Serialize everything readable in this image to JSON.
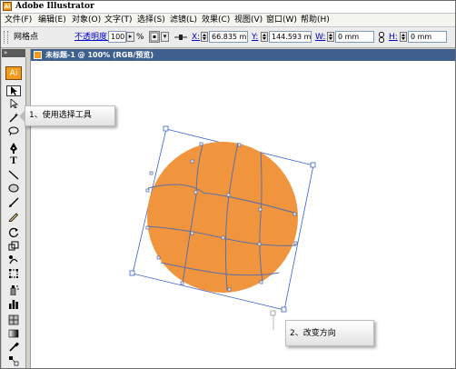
{
  "app": {
    "title": "Adobe Illustrator",
    "icon_text": "Ai"
  },
  "menu": [
    "文件(F)",
    "编辑(E)",
    "对象(O)",
    "文字(T)",
    "选择(S)",
    "滤镜(L)",
    "效果(C)",
    "视图(V)",
    "窗口(W)",
    "帮助(H)"
  ],
  "control_bar": {
    "selection_label": "网格点",
    "opacity_label": "不透明度:",
    "opacity_value": "100",
    "percent": "%",
    "x_label": "X:",
    "x_value": "66.835 mm",
    "y_label": "Y:",
    "y_value": "144.593 mm",
    "w_label": "W:",
    "w_value": "0 mm",
    "h_label": "H:",
    "h_value": "0 mm"
  },
  "toolbox": {
    "logo": "Ai",
    "tools": [
      "selection-tool",
      "direct-selection-tool",
      "magic-wand-tool",
      "lasso-tool",
      "pen-tool",
      "type-tool",
      "line-segment-tool",
      "ellipse-tool",
      "paintbrush-tool",
      "pencil-tool",
      "rotate-tool",
      "scale-tool",
      "warp-tool",
      "free-transform-tool",
      "symbol-sprayer-tool",
      "column-graph-tool",
      "mesh-tool",
      "gradient-tool",
      "eyedropper-tool",
      "blend-tool"
    ],
    "type_glyph": "T"
  },
  "document": {
    "tab_title": "未标题-1 @ 100% (RGB/预览)"
  },
  "callouts": {
    "step1": "1、使用选择工具",
    "step2": "2、改变方向"
  },
  "colors": {
    "sphere_fill": "#F0953E",
    "mesh_line": "#5B6FA8",
    "bounding_box": "#3A5FCD",
    "brand_orange": "#F29A1D"
  }
}
